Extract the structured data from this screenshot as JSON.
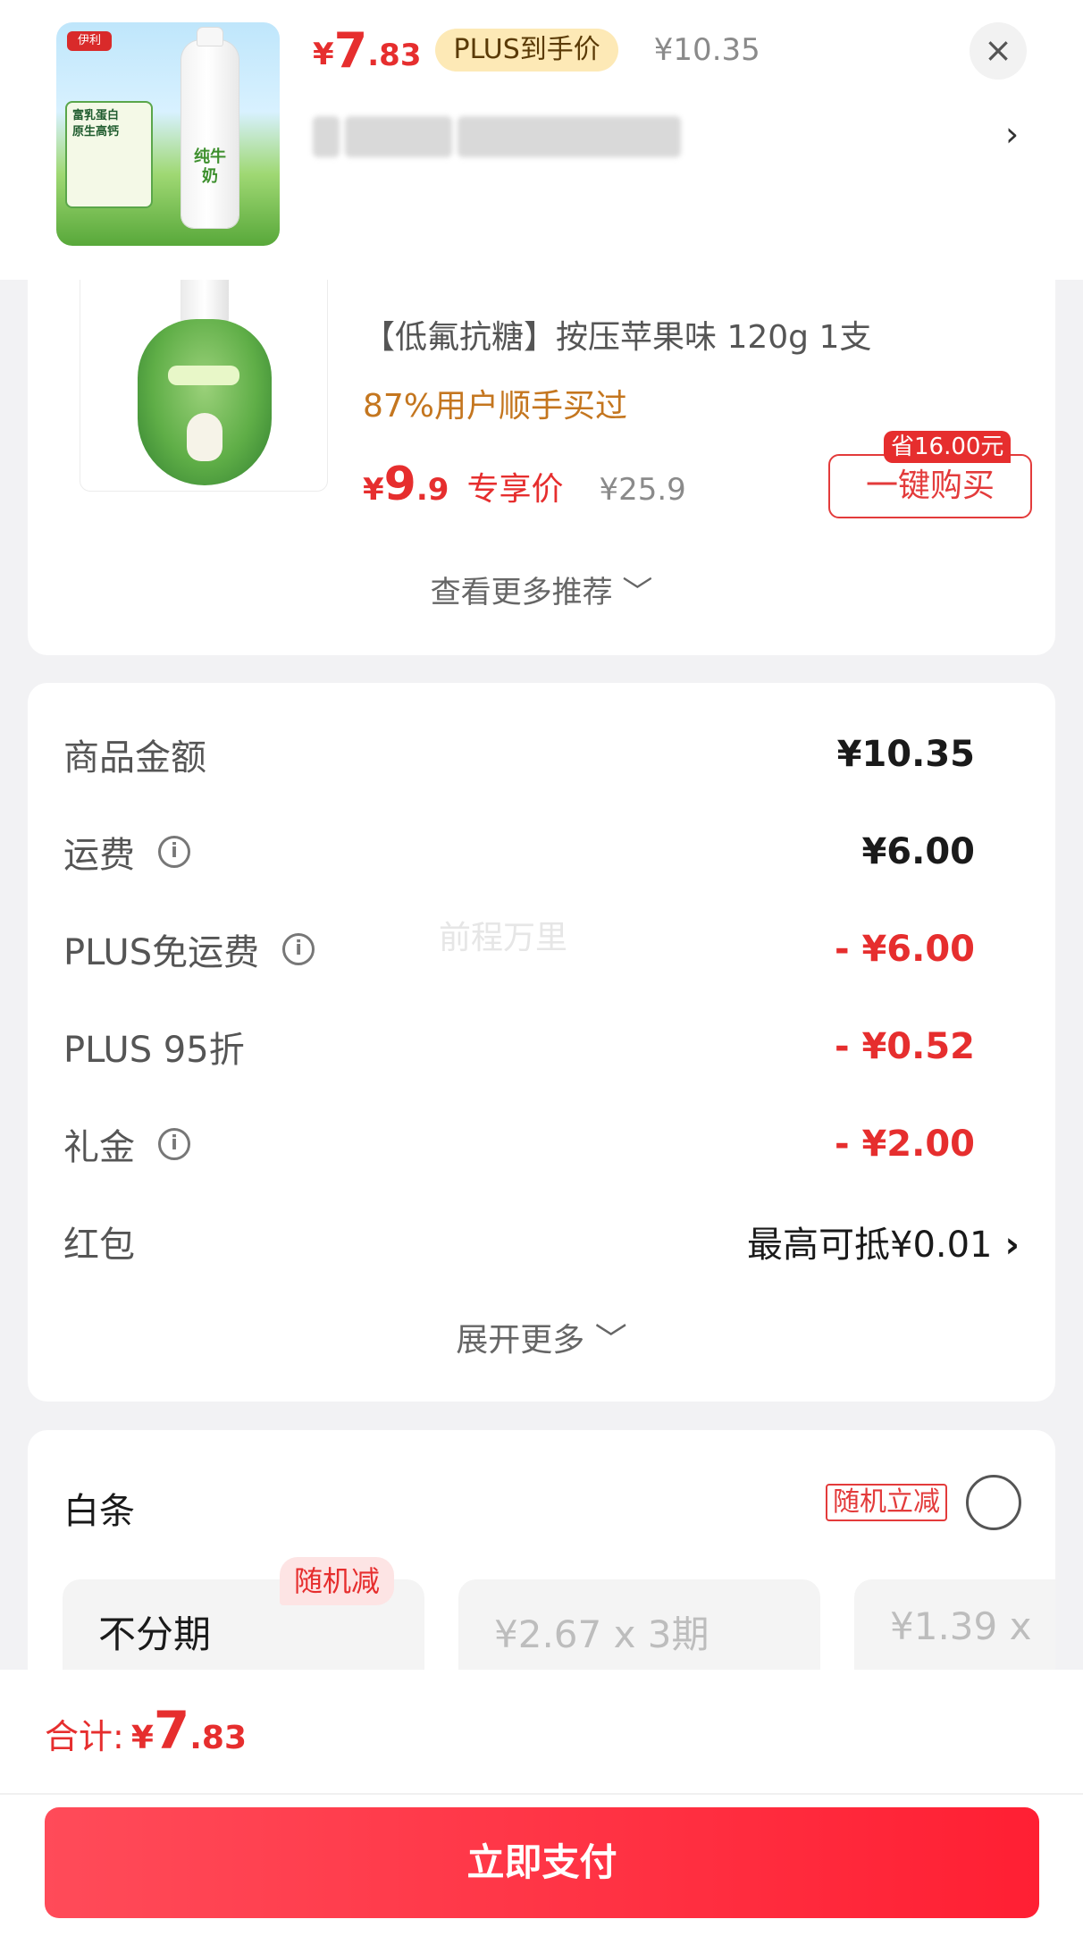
{
  "header": {
    "price_yen": "¥",
    "price_int": "7",
    "price_dec": ".83",
    "plus_label": "PLUS到手价",
    "original_price": "¥10.35",
    "close_icon": "×",
    "spec_arrow": "›",
    "thumb_brand": "伊利",
    "thumb_promo_line1": "富乳蛋白",
    "thumb_promo_line2": "原生高钙",
    "thumb_bottle_label": "纯牛奶"
  },
  "recommend": {
    "spec": "【低氟抗糖】按压苹果味 120g 1支",
    "bought": "87%用户顺手买过",
    "price_yen": "¥",
    "price_int": "9",
    "price_dec": ".9",
    "exclusive_label": "专享价",
    "original_price": "¥25.9",
    "save_badge": "省16.00元",
    "buy_button": "一键购买",
    "more_label": "查看更多推荐 ﹀"
  },
  "fees": {
    "rows": [
      {
        "label": "商品金额",
        "value": "¥10.35",
        "info": false,
        "red": false
      },
      {
        "label": "运费",
        "value": "¥6.00",
        "info": true,
        "red": false
      },
      {
        "label": "PLUS免运费",
        "value": "- ¥6.00",
        "info": true,
        "red": true
      },
      {
        "label": "PLUS 95折",
        "value": "- ¥0.52",
        "info": false,
        "red": true
      },
      {
        "label": "礼金",
        "value": "- ¥2.00",
        "info": true,
        "red": true
      }
    ],
    "hongbao_label": "红包",
    "hongbao_value": "最高可抵¥0.01",
    "hongbao_chevron": "›",
    "watermark": "前程万里",
    "expand_label": "展开更多 ﹀"
  },
  "baitiao": {
    "title": "白条",
    "random_tag": "随机立减",
    "plans": [
      {
        "label": "不分期",
        "badge": "随机减",
        "active": true
      },
      {
        "label": "¥2.67 x 3期",
        "active": false
      },
      {
        "label": "¥1.39 x",
        "active": false
      }
    ]
  },
  "bottom": {
    "total_label": "合计:",
    "total_yen": "¥",
    "total_int": "7",
    "total_dec": ".83",
    "pay_button": "立即支付"
  }
}
